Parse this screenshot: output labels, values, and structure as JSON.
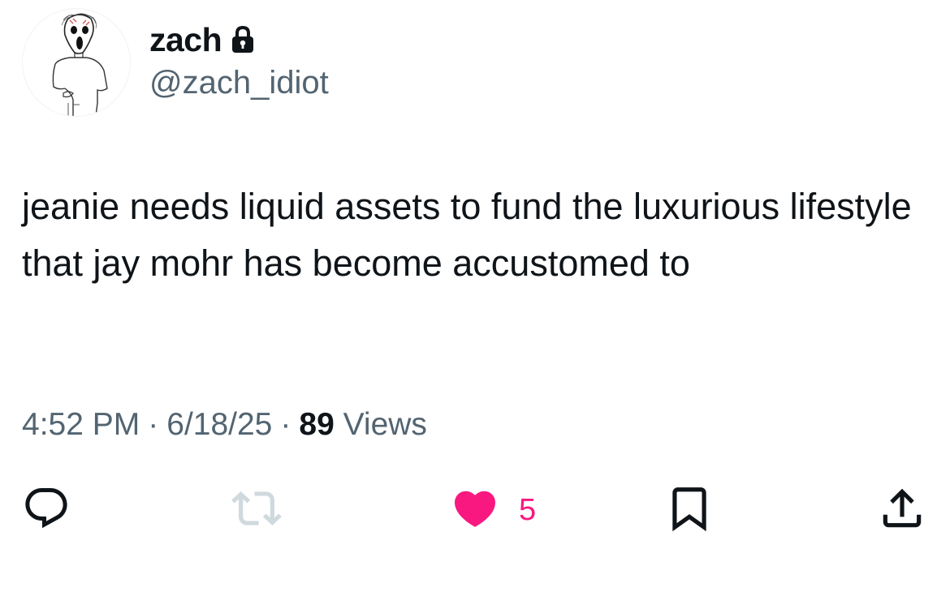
{
  "author": {
    "display_name": "zach",
    "handle": "@zach_idiot",
    "protected_icon": "lock-icon",
    "avatar": "scream-mask-sketch"
  },
  "tweet": {
    "text": "jeanie needs liquid assets to fund the luxurious lifestyle that jay mohr has become accustomed to"
  },
  "meta": {
    "time": "4:52 PM",
    "separator": "·",
    "date": "6/18/25",
    "views_count": "89",
    "views_label": "Views"
  },
  "actions": {
    "reply_icon": "reply-icon",
    "retweet_icon": "retweet-icon",
    "like_icon": "heart-icon",
    "like_count": "5",
    "liked": true,
    "bookmark_icon": "bookmark-icon",
    "share_icon": "share-icon"
  },
  "colors": {
    "text_primary": "#0f1419",
    "text_secondary": "#536471",
    "like_active": "#f91880",
    "retweet_disabled": "#cfd9de"
  }
}
